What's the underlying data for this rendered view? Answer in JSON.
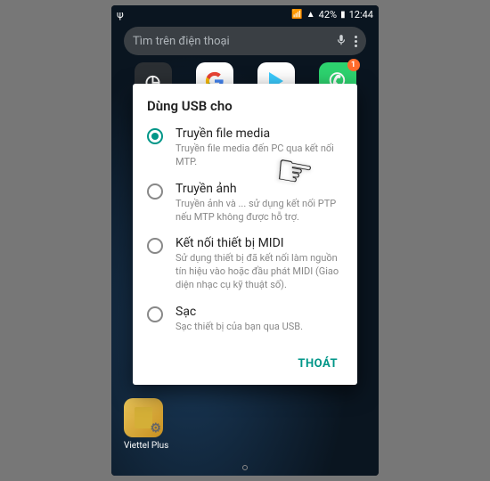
{
  "status": {
    "usb_icon": "ψ",
    "signal": "📶",
    "wifi": "▲",
    "battery_pct": "42%",
    "battery_icon": "▮",
    "time": "12:44"
  },
  "search": {
    "placeholder": "Tìm trên điện thoại"
  },
  "apps": {
    "clock_glyph": "◷",
    "phone_glyph": "✆",
    "phone_badge": "1",
    "bottom_label": "Viettel Plus"
  },
  "dialog": {
    "title": "Dùng USB cho",
    "options": [
      {
        "title": "Truyền file media",
        "desc": "Truyền file media đến PC qua kết nối MTP.",
        "selected": true
      },
      {
        "title": "Truyền ảnh",
        "desc": "Truyền ảnh và ... sử dụng kết nối PTP nếu MTP không được hỗ trợ.",
        "selected": false
      },
      {
        "title": "Kết nối thiết bị MIDI",
        "desc": "Sử dụng thiết bị đã kết nối làm nguồn tín hiệu vào hoặc đầu phát MIDI (Giao diện nhạc cụ kỹ thuật số).",
        "selected": false
      },
      {
        "title": "Sạc",
        "desc": "Sạc thiết bị của bạn qua USB.",
        "selected": false
      }
    ],
    "action": "THOÁT"
  }
}
